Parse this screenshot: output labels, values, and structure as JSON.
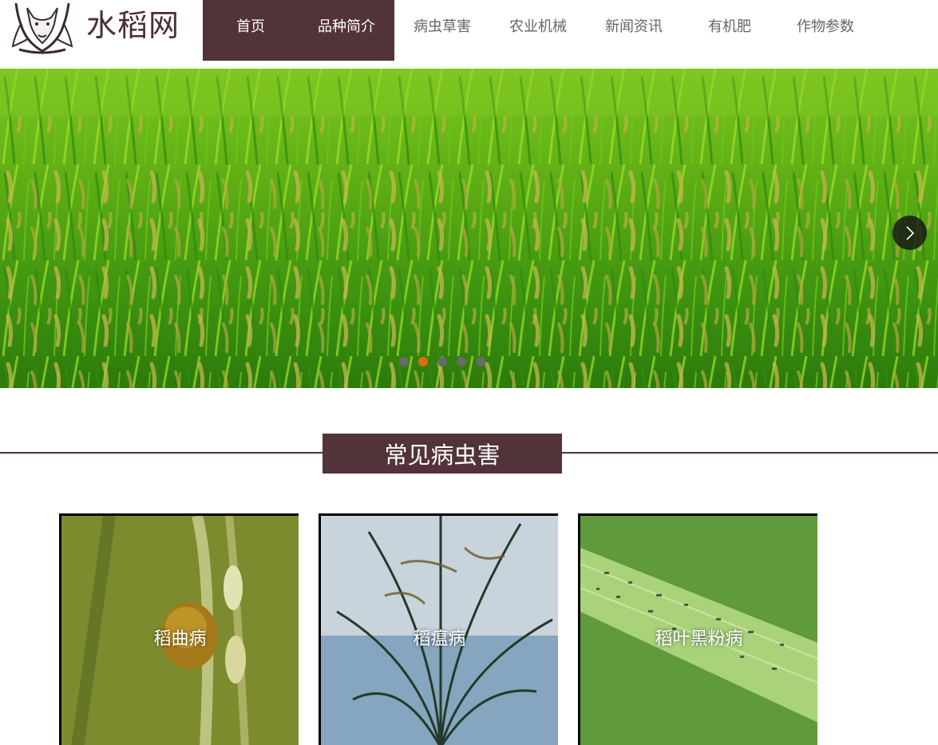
{
  "site": {
    "logo_text": "水稻网"
  },
  "nav": {
    "items": [
      {
        "label": "首页",
        "active": true
      },
      {
        "label": "品种简介",
        "active": true
      },
      {
        "label": "病虫草害",
        "active": false
      },
      {
        "label": "农业机械",
        "active": false
      },
      {
        "label": "新闻资讯",
        "active": false
      },
      {
        "label": "有机肥",
        "active": false
      },
      {
        "label": "作物参数",
        "active": false
      }
    ]
  },
  "banner": {
    "slide_count": 5,
    "active_slide": 2,
    "next_icon": "chevron-right-icon"
  },
  "section": {
    "title": "常见病虫害"
  },
  "cards": [
    {
      "label": "稻曲病"
    },
    {
      "label": "稻瘟病"
    },
    {
      "label": "稻叶黑粉病"
    }
  ],
  "colors": {
    "brand": "#523339",
    "active_dot": "#e36a10",
    "dot": "#6a6a6a"
  }
}
